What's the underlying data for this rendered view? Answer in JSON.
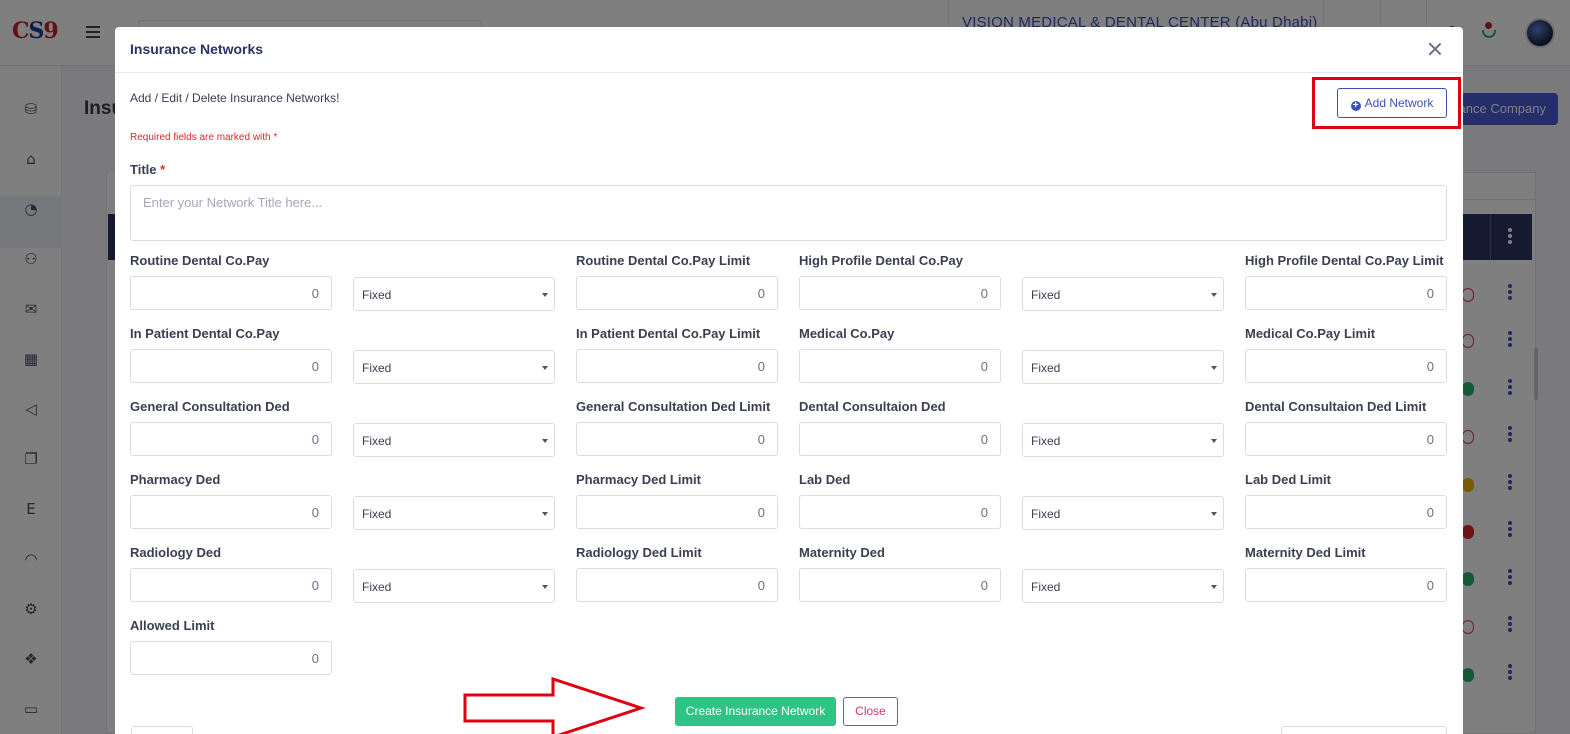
{
  "app": {
    "logo_c": "C",
    "logo_s": "S",
    "logo_9": "9",
    "clinic_name": "VISION MEDICAL & DENTAL CENTER (Abu Dhabi)",
    "page_title": "Insu",
    "add_company_button": "urance Company"
  },
  "modal": {
    "title": "Insurance Networks",
    "subtitle": "Add / Edit / Delete Insurance Networks!",
    "required_note": "Required fields are marked with *",
    "add_network_label": "Add Network",
    "title_label": "Title",
    "title_required_mark": "*",
    "title_placeholder": "Enter your Network Title here...",
    "title_value": "",
    "fields": [
      {
        "label": "Routine Dental Co.Pay",
        "value": "0",
        "type": "Fixed"
      },
      {
        "label": "Routine Dental Co.Pay Limit",
        "value": "0"
      },
      {
        "label": "High Profile Dental Co.Pay",
        "value": "0",
        "type": "Fixed"
      },
      {
        "label": "High Profile Dental Co.Pay Limit",
        "value": "0"
      },
      {
        "label": "In Patient Dental Co.Pay",
        "value": "0",
        "type": "Fixed"
      },
      {
        "label": "In Patient Dental Co.Pay Limit",
        "value": "0"
      },
      {
        "label": "Medical Co.Pay",
        "value": "0",
        "type": "Fixed"
      },
      {
        "label": "Medical Co.Pay Limit",
        "value": "0"
      },
      {
        "label": "General Consultation Ded",
        "value": "0",
        "type": "Fixed"
      },
      {
        "label": "General Consultation Ded Limit",
        "value": "0"
      },
      {
        "label": "Dental Consultaion Ded",
        "value": "0",
        "type": "Fixed"
      },
      {
        "label": "Dental Consultaion Ded Limit",
        "value": "0"
      },
      {
        "label": "Pharmacy Ded",
        "value": "0",
        "type": "Fixed"
      },
      {
        "label": "Pharmacy Ded Limit",
        "value": "0"
      },
      {
        "label": "Lab Ded",
        "value": "0",
        "type": "Fixed"
      },
      {
        "label": "Lab Ded Limit",
        "value": "0"
      },
      {
        "label": "Radiology Ded",
        "value": "0",
        "type": "Fixed"
      },
      {
        "label": "Radiology Ded Limit",
        "value": "0"
      },
      {
        "label": "Maternity Ded",
        "value": "0",
        "type": "Fixed"
      },
      {
        "label": "Maternity Ded Limit",
        "value": "0"
      },
      {
        "label": "Allowed Limit",
        "value": "0"
      }
    ],
    "create_button": "Create Insurance Network",
    "close_button": "Close"
  },
  "colors": {
    "brand_primary": "#3a52b8",
    "success": "#2ec483",
    "danger": "#d63377",
    "required": "#e0262d",
    "highlight": "#e0000f"
  }
}
